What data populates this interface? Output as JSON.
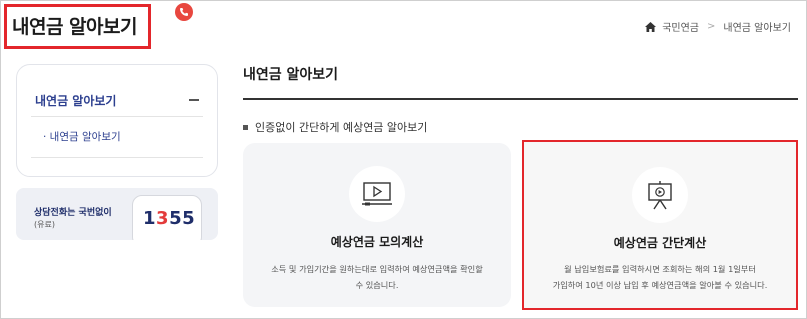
{
  "header": {
    "page_title": "내연금 알아보기",
    "breadcrumb": [
      "국민연금",
      "내연금 알아보기"
    ],
    "home_icon": "home-icon"
  },
  "sidebar": {
    "menu_title": "내연금 알아보기",
    "sub_item": "· 내연금 알아보기",
    "call": {
      "title": "상담전화는 국번없이",
      "sub": "(유료)",
      "number_part1": "1",
      "number_part2": "3",
      "number_part3": "55",
      "badge_icon": "phone-icon"
    }
  },
  "main": {
    "title": "내연금 알아보기",
    "intro": "인증없이 간단하게 예상연금 알아보기",
    "cards": [
      {
        "title": "예상연금 모의계산",
        "desc_line1": "소득 및 가입기간을 원하는대로 입력하여 예상연금액을 확인할",
        "desc_line2": "수 있습니다.",
        "icon": "monitor-play-icon"
      },
      {
        "title": "예상연금 간단계산",
        "desc_line1": "월 납입보험료를 입력하시면 조회하는 해의 1월 1일부터",
        "desc_line2": "가입하여 10년 이상 납입 후 예상연금액을 알아볼 수 있습니다.",
        "icon": "presentation-board-icon"
      }
    ]
  },
  "colors": {
    "highlight": "#e3262b",
    "navy": "#2c3f8f",
    "card_bg": "#f4f5f7"
  }
}
